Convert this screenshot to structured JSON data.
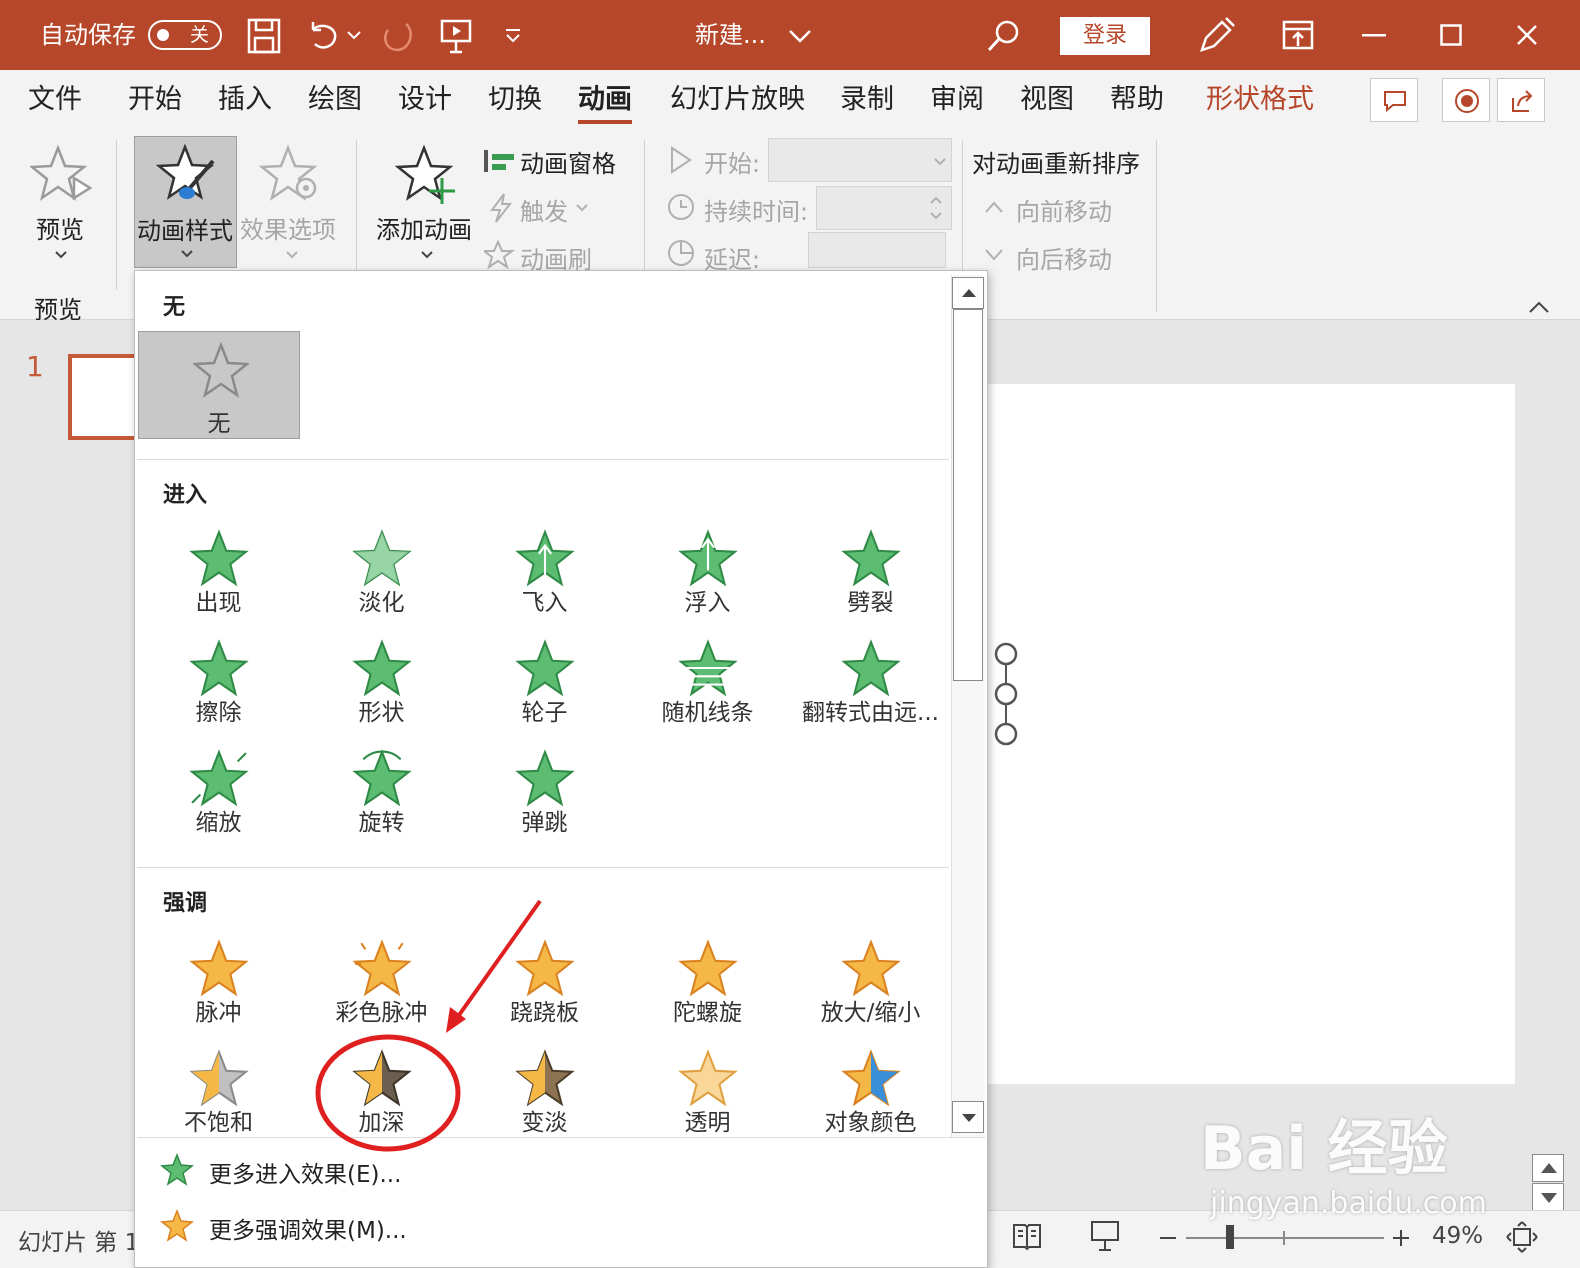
{
  "titlebar": {
    "autosave_label": "自动保存",
    "autosave_state": "关",
    "doc_name": "新建...",
    "login": "登录"
  },
  "tabs": [
    {
      "label": "文件"
    },
    {
      "label": "开始"
    },
    {
      "label": "插入"
    },
    {
      "label": "绘图"
    },
    {
      "label": "设计"
    },
    {
      "label": "切换"
    },
    {
      "label": "动画"
    },
    {
      "label": "幻灯片放映"
    },
    {
      "label": "录制"
    },
    {
      "label": "审阅"
    },
    {
      "label": "视图"
    },
    {
      "label": "帮助"
    },
    {
      "label": "形状格式"
    }
  ],
  "ribbon": {
    "preview": "预览",
    "preview_group": "预览",
    "animation_styles": "动画样式",
    "effect_options": "效果选项",
    "add_animation": "添加动画",
    "animation_pane": "动画窗格",
    "trigger": "触发",
    "animation_painter": "动画刷",
    "start": "开始:",
    "duration": "持续时间:",
    "delay": "延迟:",
    "reorder": "对动画重新排序",
    "move_earlier": "向前移动",
    "move_later": "向后移动"
  },
  "gallery": {
    "none_section": "无",
    "none_item": "无",
    "entrance_section": "进入",
    "entrance": [
      {
        "name": "出现"
      },
      {
        "name": "淡化"
      },
      {
        "name": "飞入"
      },
      {
        "name": "浮入"
      },
      {
        "name": "劈裂"
      },
      {
        "name": "擦除"
      },
      {
        "name": "形状"
      },
      {
        "name": "轮子"
      },
      {
        "name": "随机线条"
      },
      {
        "name": "翻转式由远..."
      },
      {
        "name": "缩放"
      },
      {
        "name": "旋转"
      },
      {
        "name": "弹跳"
      }
    ],
    "emphasis_section": "强调",
    "emphasis": [
      {
        "name": "脉冲"
      },
      {
        "name": "彩色脉冲"
      },
      {
        "name": "跷跷板"
      },
      {
        "name": "陀螺旋"
      },
      {
        "name": "放大/缩小"
      },
      {
        "name": "不饱和"
      },
      {
        "name": "加深"
      },
      {
        "name": "变淡"
      },
      {
        "name": "透明"
      },
      {
        "name": "对象颜色"
      }
    ],
    "more_entrance": "更多进入效果(E)...",
    "more_emphasis": "更多强调效果(M)..."
  },
  "slides": {
    "slide_number": "1"
  },
  "statusbar": {
    "slide_info": "幻灯片 第 1",
    "zoom": "49%"
  },
  "watermark": {
    "brand": "Bai 经验",
    "url": "jingyan.baidu.com"
  },
  "colors": {
    "accent": "#b7472a",
    "entrance_star": "#5cbd72",
    "emphasis_star": "#f5b847",
    "annotation": "#e02020"
  }
}
